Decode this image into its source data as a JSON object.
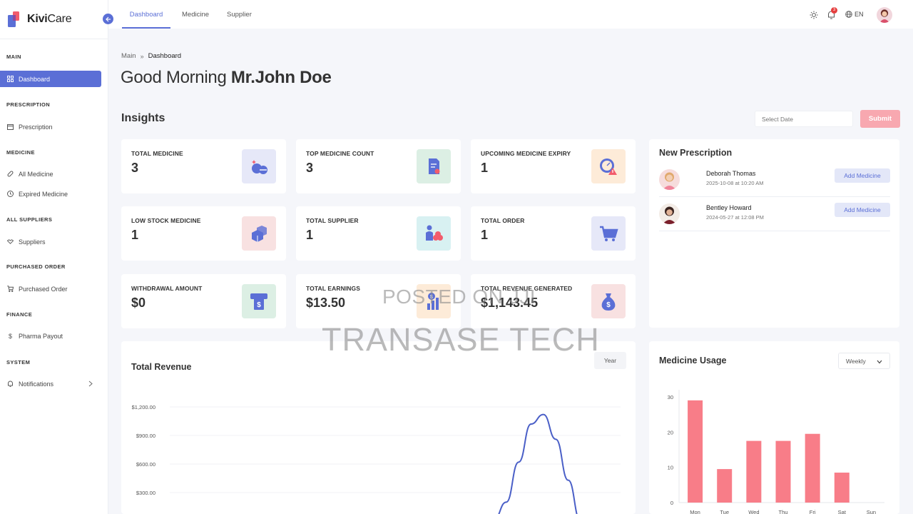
{
  "app": {
    "brand_bold": "Kivi",
    "brand_rest": "Care",
    "language": "EN",
    "notification_count": "3"
  },
  "topnav": {
    "tabs": [
      {
        "label": "Dashboard",
        "active": true
      },
      {
        "label": "Medicine"
      },
      {
        "label": "Supplier"
      }
    ]
  },
  "sidebar": {
    "main_section": "MAIN",
    "dashboard": "Dashboard",
    "prescription_section": "PRESCRIPTION",
    "prescription": "Prescription",
    "medicine_section": "MEDICINE",
    "all_medicine": "All Medicine",
    "expired_medicine": "Expired Medicine",
    "suppliers_section": "ALL SUPPLIERS",
    "suppliers": "Suppliers",
    "purchased_section": "PURCHASED ORDER",
    "purchased_order": "Purchased Order",
    "finance_section": "FINANCE",
    "pharma_payout": "Pharma Payout",
    "system_section": "SYSTEM",
    "notifications": "Notifications"
  },
  "breadcrumb": {
    "root": "Main",
    "current": "Dashboard"
  },
  "greeting": {
    "prefix": "Good Morning",
    "name": "Mr.John Doe"
  },
  "insights": {
    "title": "Insights",
    "date_placeholder": "Select Date",
    "submit": "Submit",
    "cards": [
      {
        "label": "TOTAL MEDICINE",
        "value": "3",
        "icon": "pills-icon",
        "bg": "#e6e8f8"
      },
      {
        "label": "TOP MEDICINE COUNT",
        "value": "3",
        "icon": "document-icon",
        "bg": "#dcefe4"
      },
      {
        "label": "UPCOMING MEDICINE EXPIRY",
        "value": "1",
        "icon": "expiry-alert-icon",
        "bg": "#fdebd8"
      },
      {
        "label": "LOW STOCK MEDICINE",
        "value": "1",
        "icon": "boxes-icon",
        "bg": "#f8e1e1"
      },
      {
        "label": "TOTAL SUPPLIER",
        "value": "1",
        "icon": "supplier-icon",
        "bg": "#d8f1f2"
      },
      {
        "label": "TOTAL ORDER",
        "value": "1",
        "icon": "cart-icon",
        "bg": "#e6e8f8"
      },
      {
        "label": "WITHDRAWAL AMOUNT",
        "value": "$0",
        "icon": "atm-icon",
        "bg": "#dcefe4"
      },
      {
        "label": "TOTAL EARNINGS",
        "value": "$13.50",
        "icon": "earnings-chart-icon",
        "bg": "#fdebd8"
      },
      {
        "label": "TOTAL REVENUE GENERATED",
        "value": "$1,143.45",
        "icon": "money-bag-icon",
        "bg": "#f8e1e1"
      }
    ]
  },
  "new_prescription": {
    "title": "New Prescription",
    "items": [
      {
        "name": "Deborah Thomas",
        "date": "2025-10-08 at 10:20 AM",
        "button": "Add Medicine"
      },
      {
        "name": "Bentley Howard",
        "date": "2024-05-27 at 12:08 PM",
        "button": "Add Medicine"
      }
    ]
  },
  "total_revenue": {
    "title": "Total Revenue",
    "period": "Year"
  },
  "medicine_usage": {
    "title": "Medicine Usage",
    "period": "Weekly"
  },
  "watermark": {
    "line1": "POSTED ON JJI",
    "line2": "TRANSASE TECH"
  },
  "chart_data": [
    {
      "type": "line",
      "title": "Total Revenue",
      "ytick_labels": [
        "$300.00",
        "$600.00",
        "$900.00",
        "$1,200.00"
      ],
      "yticks": [
        300,
        600,
        900,
        1200
      ],
      "ylim": [
        0,
        1350
      ],
      "series": [
        {
          "x": [
            0,
            0.5,
            1,
            1.5,
            2,
            2.5,
            3,
            3.5,
            4
          ],
          "y": [
            0,
            15,
            200,
            620,
            1020,
            1120,
            860,
            430,
            0
          ]
        }
      ],
      "color": "#4a5fc7"
    },
    {
      "type": "bar",
      "title": "Medicine Usage",
      "categories": [
        "Mon",
        "Tue",
        "Wed",
        "Thu",
        "Fri",
        "Sat",
        "Sun"
      ],
      "values": [
        29,
        9.5,
        17.5,
        17.5,
        19.5,
        8.5,
        0
      ],
      "yticks": [
        0,
        10,
        20,
        30
      ],
      "ylim": [
        0,
        32
      ],
      "color": "#f87d88"
    }
  ]
}
